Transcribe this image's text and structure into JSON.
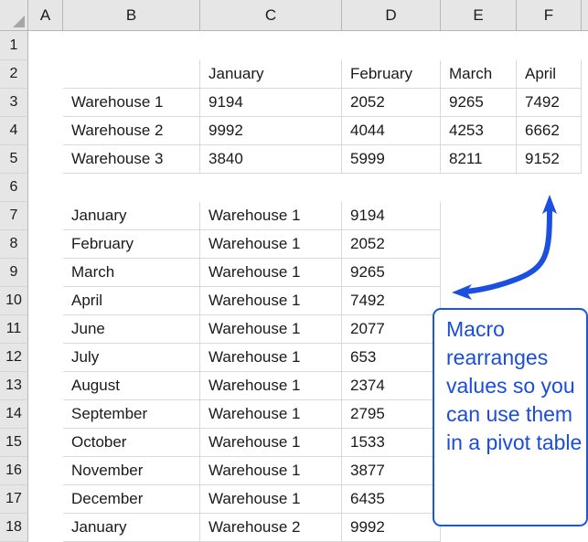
{
  "app": {
    "kind": "spreadsheet",
    "accent_color": "#1b4ddb",
    "grid_line_color": "#d9d9d9",
    "header_fill": "#e6e6e6"
  },
  "grid": {
    "column_headers": [
      "A",
      "B",
      "C",
      "D",
      "E",
      "F"
    ],
    "row_headers": [
      "1",
      "2",
      "3",
      "4",
      "5",
      "6",
      "7",
      "8",
      "9",
      "10",
      "11",
      "12",
      "13",
      "14",
      "15",
      "16",
      "17",
      "18"
    ]
  },
  "pivot_source_table": {
    "range_note": "B2:F5",
    "header_row": [
      "",
      "January",
      "February",
      "March",
      "April"
    ],
    "rows": [
      {
        "label": "Warehouse 1",
        "values": [
          "9194",
          "2052",
          "9265",
          "7492"
        ]
      },
      {
        "label": "Warehouse 2",
        "values": [
          "9992",
          "4044",
          "4253",
          "6662"
        ]
      },
      {
        "label": "Warehouse 3",
        "values": [
          "3840",
          "5999",
          "8211",
          "9152"
        ]
      }
    ]
  },
  "rearranged_table": {
    "range_note": "B7:D18",
    "rows": [
      {
        "month": "January",
        "warehouse": "Warehouse 1",
        "value": "9194"
      },
      {
        "month": "February",
        "warehouse": "Warehouse 1",
        "value": "2052"
      },
      {
        "month": "March",
        "warehouse": "Warehouse 1",
        "value": "9265"
      },
      {
        "month": "April",
        "warehouse": "Warehouse 1",
        "value": "7492"
      },
      {
        "month": "June",
        "warehouse": "Warehouse 1",
        "value": "2077"
      },
      {
        "month": "July",
        "warehouse": "Warehouse 1",
        "value": "653"
      },
      {
        "month": "August",
        "warehouse": "Warehouse 1",
        "value": "2374"
      },
      {
        "month": "September",
        "warehouse": "Warehouse 1",
        "value": "2795"
      },
      {
        "month": "October",
        "warehouse": "Warehouse 1",
        "value": "1533"
      },
      {
        "month": "November",
        "warehouse": "Warehouse 1",
        "value": "3877"
      },
      {
        "month": "December",
        "warehouse": "Warehouse 1",
        "value": "6435"
      },
      {
        "month": "January",
        "warehouse": "Warehouse 2",
        "value": "9992"
      }
    ]
  },
  "annotation": {
    "callout_text": "Macro rearranges values so you can use them in a pivot table",
    "arrow_name": "curved-double-arrow",
    "color": "#1b4ddb"
  }
}
